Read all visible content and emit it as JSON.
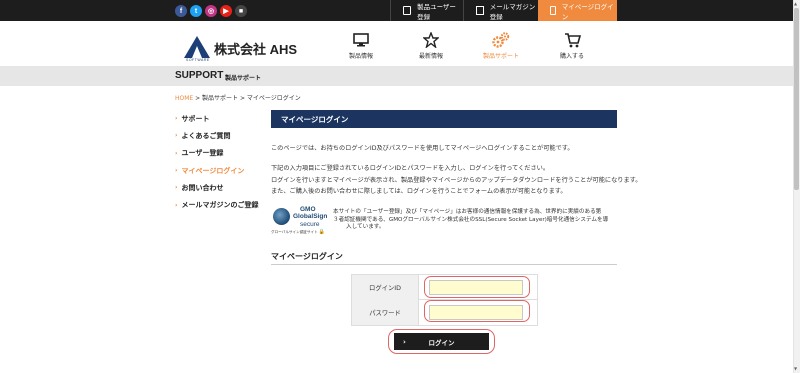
{
  "social": [
    {
      "icon": "facebook-icon",
      "glyph": "f",
      "color": "#3b5998"
    },
    {
      "icon": "twitter-icon",
      "glyph": "t",
      "color": "#1da1f2"
    },
    {
      "icon": "instagram-icon",
      "glyph": "◎",
      "color": "#c13584"
    },
    {
      "icon": "youtube-icon",
      "glyph": "▶",
      "color": "#e62117"
    },
    {
      "icon": "blog-icon",
      "glyph": "■",
      "color": "#444444"
    }
  ],
  "topnav": {
    "product_register": "製品ユーザー登録",
    "newsletter_register": "メールマガジン登録",
    "mypage_login": "マイページログイン"
  },
  "logo": {
    "text": "株式会社 AHS",
    "sub": "SOFTWARE"
  },
  "mainnav": {
    "products": "製品情報",
    "news": "最新情報",
    "support": "製品サポート",
    "purchase": "購入する"
  },
  "band": {
    "title": "SUPPORT",
    "sub": "製品サポート"
  },
  "breadcrumb": {
    "home": "HOME",
    "rest": " > 製品サポート > マイページログイン"
  },
  "sidemenu": [
    "サポート",
    "よくあるご質問",
    "ユーザー登録",
    "マイページログイン",
    "お問い合わせ",
    "メールマガジンのご登録"
  ],
  "content": {
    "heading": "マイページログイン",
    "p1": "このページでは、お持ちのログインID及びパスワードを使用してマイページへログインすることが可能です。",
    "p2": "下記の入力項目にご登録されているログインIDとパスワードを入力し、ログインを行ってください。",
    "p3": "ログインを行いますとマイページが表示され、製品登録やマイページからのアップデータダウンロードを行うことが可能になります。",
    "p4": "また、ご購入後のお問い合わせに際しましては、ログインを行うことでフォームの表示が可能となります。"
  },
  "gmo": {
    "t1": "GMO",
    "t2": "GlobalSign",
    "t3": "secure",
    "caption": "グローバルサイン認証サイト",
    "line1": "本サイトの「ユーザー登録」及び「マイページ」はお客様の通信情報を保護する為、世界的に実績のある第",
    "line2": "３者認証機関である、GMOグローバルサイン株式会社のSSL(Secure Socket Layer)暗号化通信システムを導",
    "line3": "入しています。"
  },
  "login": {
    "section_title": "マイページログイン",
    "id_label": "ログインID",
    "id_value": "",
    "pw_label": "パスワード",
    "pw_value": "",
    "button_label": "ログイン"
  },
  "colors": {
    "accent": "#f08a3e",
    "navy": "#1b3560",
    "input_bg": "#fffdd0",
    "highlight": "#e06666"
  }
}
